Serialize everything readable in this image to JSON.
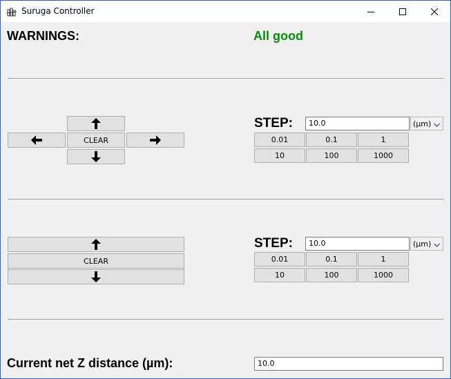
{
  "window": {
    "title": "Suruga Controller",
    "controls": [
      "minimize-icon",
      "maximize-icon",
      "close-icon"
    ]
  },
  "warnings": {
    "label": "WARNINGS:",
    "status": "All good",
    "status_color": "#0a8a0a"
  },
  "xy_pad": {
    "up_icon": "arrow-up-icon",
    "left_icon": "arrow-left-icon",
    "right_icon": "arrow-right-icon",
    "down_icon": "arrow-down-icon",
    "clear_label": "CLEAR"
  },
  "xy_step": {
    "label": "STEP:",
    "value": "10.0",
    "unit": "(µm)",
    "presets": [
      "0.01",
      "0.1",
      "1",
      "10",
      "100",
      "1000"
    ]
  },
  "z_pad": {
    "up_icon": "arrow-up-icon",
    "down_icon": "arrow-down-icon",
    "clear_label": "CLEAR"
  },
  "z_step": {
    "label": "STEP:",
    "value": "10.0",
    "unit": "(µm)",
    "presets": [
      "0.01",
      "0.1",
      "1",
      "10",
      "100",
      "1000"
    ]
  },
  "z_distance": {
    "label": "Current net Z distance (µm):",
    "value": "10.0"
  }
}
